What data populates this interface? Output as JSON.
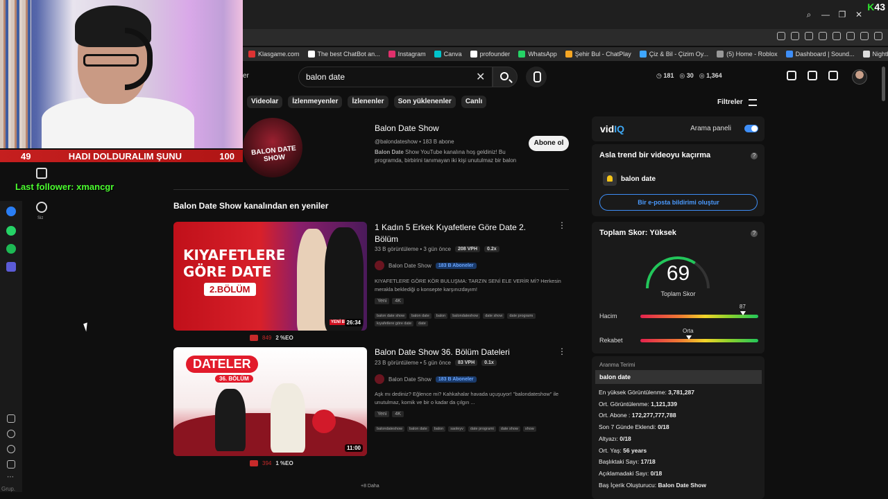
{
  "browser": {
    "corner_badge_k": "K",
    "corner_badge_num": "43",
    "bookmarks": [
      {
        "label": "Klasgame.com",
        "color": "#d33"
      },
      {
        "label": "The best ChatBot an...",
        "color": "#fff"
      },
      {
        "label": "Instagram",
        "color": "#e1306c"
      },
      {
        "label": "Canva",
        "color": "#00c4cc"
      },
      {
        "label": "profounder",
        "color": "#fff"
      },
      {
        "label": "WhatsApp",
        "color": "#25d366"
      },
      {
        "label": "Şehir Bul - ChatPlay",
        "color": "#f5a623"
      },
      {
        "label": "Çiz & Bil - Çizim Oy...",
        "color": "#3ea6ff"
      },
      {
        "label": "(5) Home - Roblox",
        "color": "#999"
      },
      {
        "label": "Dashboard | Sound...",
        "color": "#3e8ef7"
      },
      {
        "label": "Nightbot - Dashboa...",
        "color": "#ddd"
      }
    ]
  },
  "stream_overlay": {
    "goal_current": "49",
    "goal_text": "HADI DOLDURALIM ŞUNU",
    "goal_target": "100",
    "last_follower": "Last follower: xmancgr"
  },
  "sidebar": {
    "you_label": "Siz",
    "bottom_left_text": "Grup."
  },
  "search": {
    "query": "balon date",
    "filter_left": "er"
  },
  "header_stats": [
    "181",
    "30",
    "1,364"
  ],
  "chips": [
    "Videolar",
    "İzlenmeyenler",
    "İzlenenler",
    "Son yüklenenler",
    "Canlı"
  ],
  "filters_label": "Filtreler",
  "channel": {
    "avatar_text": "BALON DATE SHOW",
    "name": "Balon Date Show",
    "meta": "@balondateshow • 183 B abone",
    "description_prefix": "Balon Date",
    "description": " Show YouTube kanalına hoş geldiniz! Bu programda, birbirini tanımayan iki kişi unutulmaz bir balon",
    "subscribe_label": "Abone ol"
  },
  "section_title": "Balon Date Show kanalından en yeniler",
  "videos": [
    {
      "title": "1 Kadın 5 Erkek Kıyafetlere Göre Date 2. Bölüm",
      "meta": "33 B görüntüleme • 3 gün önce",
      "vph": "208 VPH",
      "ratio": "0.2x",
      "channel": "Balon Date Show",
      "subs": "183 B Aboneler",
      "desc": "KIYAFETLERE GÖRE KÖR BULUŞMA: TARZIN SENİ ELE VERİR Mİ? Herkesin merakla beklediği o konsepte karşınızdayım!",
      "badges": [
        "Yeni",
        "4K"
      ],
      "tags": [
        "balon date show",
        "balon date",
        "balon",
        "balondateshow",
        "date show",
        "date programı",
        "kıyafetlere göre date",
        "date"
      ],
      "thumb_line1": "KIYAFETLERE",
      "thumb_line2": "GÖRE DATE",
      "thumb_badge": "2.BÖLÜM",
      "thumb_corner": "YENİ B",
      "duration": "26:34",
      "score_left": "849",
      "score_right": "2 %EO"
    },
    {
      "title": "Balon Date Show 36. Bölüm Dateleri",
      "meta": "23 B görüntüleme • 5 gün önce",
      "vph": "83 VPH",
      "ratio": "0.1x",
      "channel": "Balon Date Show",
      "subs": "183 B Aboneler",
      "desc": "Aşk mı dediniz? Eğlence mi? Kahkahalar havada uçuşuyor! \"balondateshow\" ile unutulmaz, komik ve bir o kadar da çılgın ...",
      "badges": [
        "Yeni",
        "4K"
      ],
      "tags": [
        "balondateshow",
        "balon date",
        "balon",
        "saoleyv",
        "date programi",
        "date show",
        "show"
      ],
      "thumb_line1": "DATELER",
      "thumb_line2": "36. BÖLÜM",
      "duration": "11:00",
      "score_left": "394",
      "score_right": "1 %EO"
    }
  ],
  "more_label": "+8 Daha",
  "vidiq": {
    "logo_a": "vid",
    "logo_b": "IQ",
    "panel_label": "Arama paneli",
    "trend_title": "Asla trend bir videoyu kaçırma",
    "keyword": "balon date",
    "email_btn": "Bir e-posta bildirimi oluştur",
    "score_title": "Toplam Skor: Yüksek",
    "score_value": "69",
    "score_label": "Toplam Skor",
    "volume_label": "Hacim",
    "volume_value": "87",
    "competition_label": "Rekabet",
    "competition_value": "Orta",
    "term_header": "Aranma Terimi",
    "term": "balon date",
    "stats": [
      {
        "k": "En yüksek Görüntülenme: ",
        "v": "3,781,287"
      },
      {
        "k": "Ort. Görüntülenme: ",
        "v": "1,121,339"
      },
      {
        "k": "Ort. Abone : ",
        "v": "172,277,777,788"
      },
      {
        "k": "Son 7 Günde Eklendi: ",
        "v": "0/18"
      },
      {
        "k": "Altyazı: ",
        "v": "0/18"
      },
      {
        "k": "Ort. Yaş: ",
        "v": "56 years"
      },
      {
        "k": "Başlıktaki Sayı: ",
        "v": "17/18"
      },
      {
        "k": "Açıklamadaki Sayı: ",
        "v": "0/18"
      },
      {
        "k": "Baş İçerik Oluşturucu: ",
        "v": "Balon Date Show"
      }
    ]
  }
}
